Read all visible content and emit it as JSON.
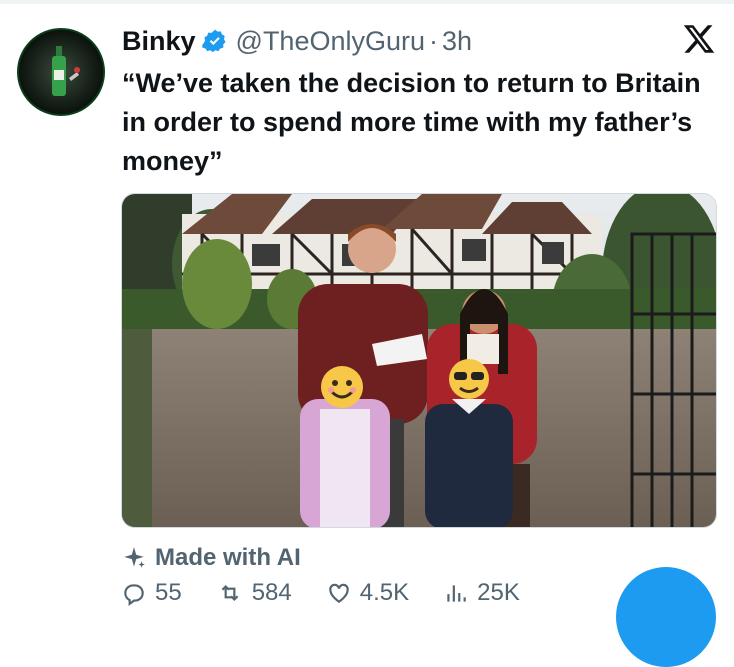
{
  "tweet": {
    "author_name": "Binky",
    "handle": "@TheOnlyGuru",
    "separator": "·",
    "time": "3h",
    "text": "“We’ve taken the decision to return to Britain in order to spend more time with my father’s money”",
    "ai_label": "Made with AI",
    "icons": {
      "verified": "verified-badge-icon",
      "platform": "x-logo-icon",
      "sparkle": "sparkle-icon"
    }
  },
  "actions": {
    "replies": "55",
    "reposts": "584",
    "likes": "4.5K",
    "views": "25K"
  },
  "colors": {
    "accent": "#1d9bf0",
    "text": "#0f1419",
    "muted": "#536471"
  }
}
